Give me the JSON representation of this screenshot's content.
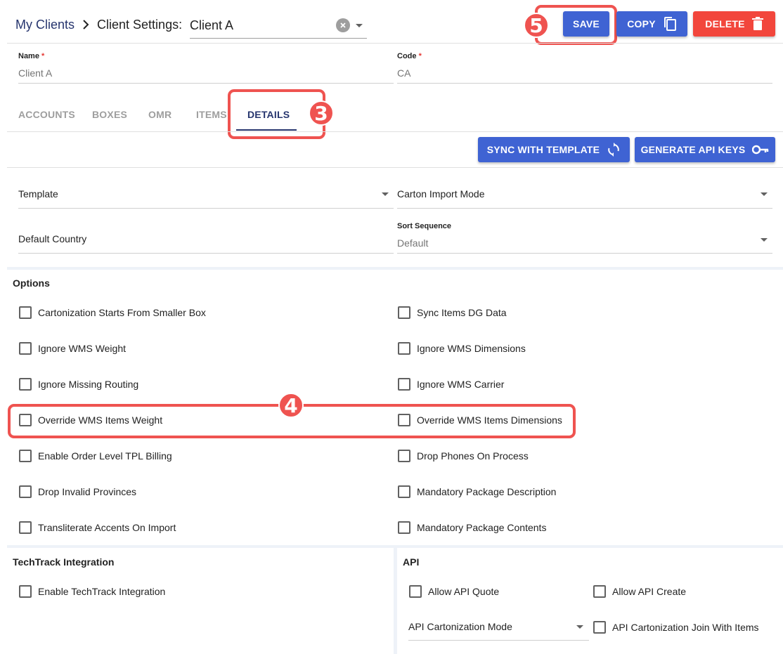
{
  "header": {
    "breadcrumb_root": "My Clients",
    "breadcrumb_current": "Client Settings:",
    "client_select_value": "Client A",
    "save_label": "SAVE",
    "copy_label": "COPY",
    "delete_label": "DELETE"
  },
  "annotations": {
    "three": "3",
    "four": "4",
    "five": "5"
  },
  "fields": {
    "name_label": "Name",
    "name_value": "Client A",
    "code_label": "Code",
    "code_value": "CA",
    "required_mark": "*"
  },
  "tabs": [
    {
      "label": "ACCOUNTS"
    },
    {
      "label": "BOXES"
    },
    {
      "label": "OMR"
    },
    {
      "label": "ITEMS"
    },
    {
      "label": "DETAILS",
      "active": true
    }
  ],
  "actions": {
    "sync_label": "SYNC WITH TEMPLATE",
    "api_keys_label": "GENERATE API KEYS"
  },
  "selects": {
    "template_label": "Template",
    "carton_import_label": "Carton Import Mode",
    "default_country_label": "Default Country",
    "sort_sequence_label": "Sort Sequence",
    "sort_sequence_value": "Default"
  },
  "options": {
    "title": "Options",
    "left": [
      "Cartonization Starts From Smaller Box",
      "Ignore WMS Weight",
      "Ignore Missing Routing",
      "Override WMS Items Weight",
      "Enable Order Level TPL Billing",
      "Drop Invalid Provinces",
      "Transliterate Accents On Import"
    ],
    "right": [
      "Sync Items DG Data",
      "Ignore WMS Dimensions",
      "Ignore WMS Carrier",
      "Override WMS Items Dimensions",
      "Drop Phones On Process",
      "Mandatory Package Description",
      "Mandatory Package Contents"
    ]
  },
  "techtrack": {
    "title": "TechTrack Integration",
    "enable_label": "Enable TechTrack Integration"
  },
  "api": {
    "title": "API",
    "allow_quote_label": "Allow API Quote",
    "allow_create_label": "Allow API Create",
    "cartonization_mode_label": "API Cartonization Mode",
    "join_items_label": "API Cartonization Join With Items"
  },
  "colors": {
    "primary": "#3f63d3",
    "danger": "#f2463c",
    "annotation": "#ef5350",
    "active_tab": "#26356e"
  }
}
